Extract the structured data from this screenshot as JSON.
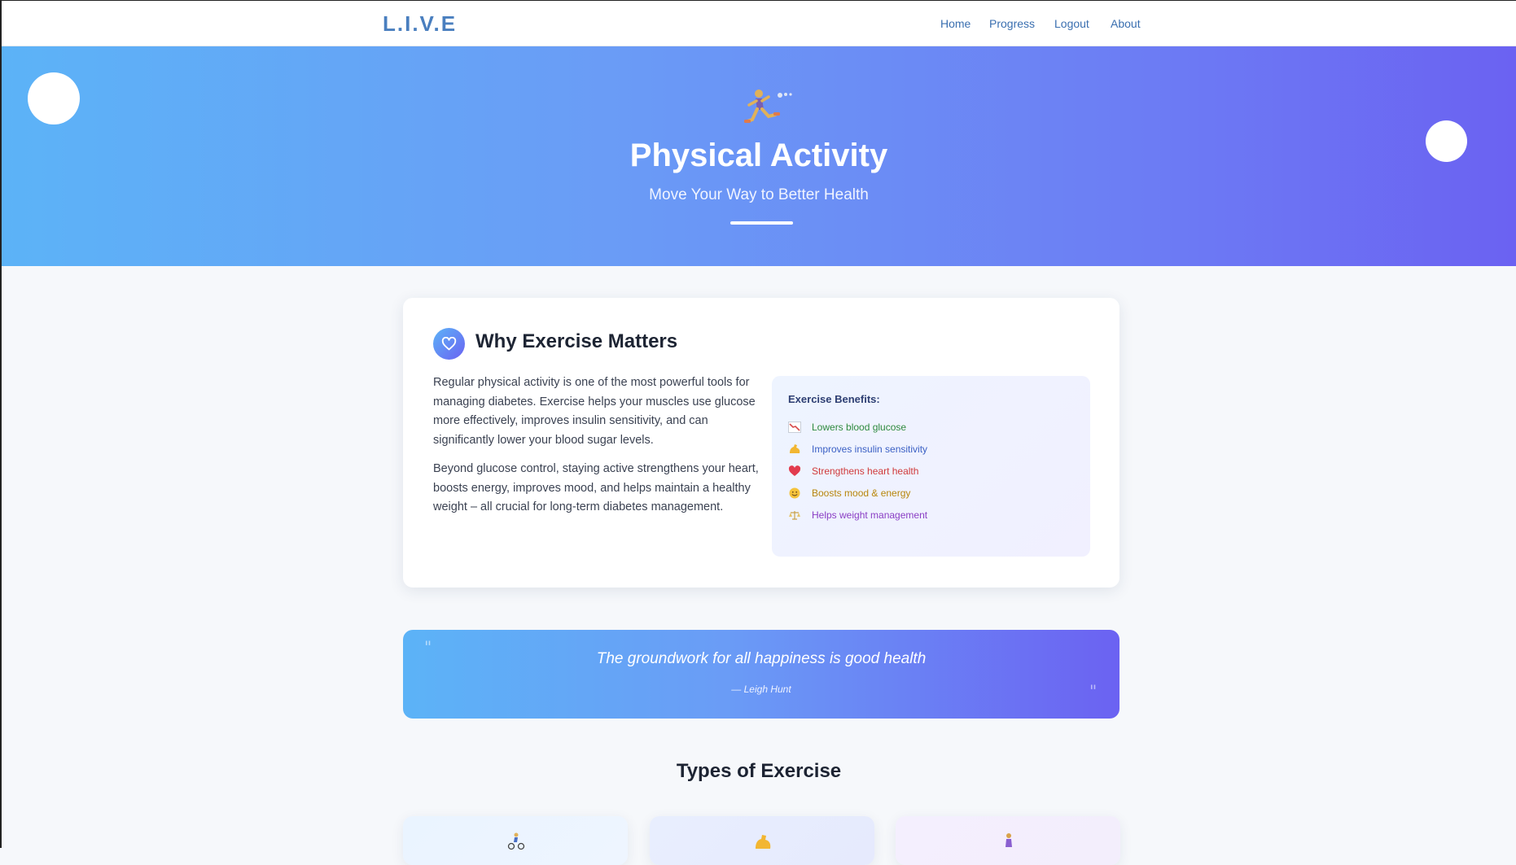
{
  "header": {
    "logo": "L.I.V.E",
    "nav": [
      "Home",
      "Progress",
      "Logout",
      "About"
    ]
  },
  "hero": {
    "icon": "runner-icon",
    "title": "Physical Activity",
    "subtitle": "Move Your Way to Better Health"
  },
  "why": {
    "icon": "heart-icon",
    "title": "Why Exercise Matters",
    "paragraphs": [
      "Regular physical activity is one of the most powerful tools for managing diabetes. Exercise helps your muscles use glucose more effectively, improves insulin sensitivity, and can significantly lower your blood sugar levels.",
      "Beyond glucose control, staying active strengthens your heart, boosts energy, improves mood, and helps maintain a healthy weight – all crucial for long-term diabetes management."
    ],
    "benefits_title": "Exercise Benefits:",
    "benefits": [
      {
        "icon": "chart-decreasing-icon",
        "label": "Lowers blood glucose",
        "color": "#2f8a3e"
      },
      {
        "icon": "flexed-biceps-icon",
        "label": "Improves insulin sensitivity",
        "color": "#3a5fc4"
      },
      {
        "icon": "red-heart-icon",
        "label": "Strengthens heart health",
        "color": "#d03a3a"
      },
      {
        "icon": "smiling-face-icon",
        "label": "Boosts mood & energy",
        "color": "#b8860b"
      },
      {
        "icon": "balance-scale-icon",
        "label": "Helps weight management",
        "color": "#8a3ec4"
      }
    ]
  },
  "quote": {
    "text": "The groundwork for all happiness is good health",
    "author": "— Leigh Hunt"
  },
  "types": {
    "title": "Types of Exercise",
    "cards": [
      {
        "icon": "cyclist-icon"
      },
      {
        "icon": "flexed-biceps-icon"
      },
      {
        "icon": "yoga-person-icon"
      }
    ]
  },
  "colors": {
    "accent": "#4a7fbf",
    "gradient_start": "#5cb3f7",
    "gradient_end": "#6b62f2"
  }
}
